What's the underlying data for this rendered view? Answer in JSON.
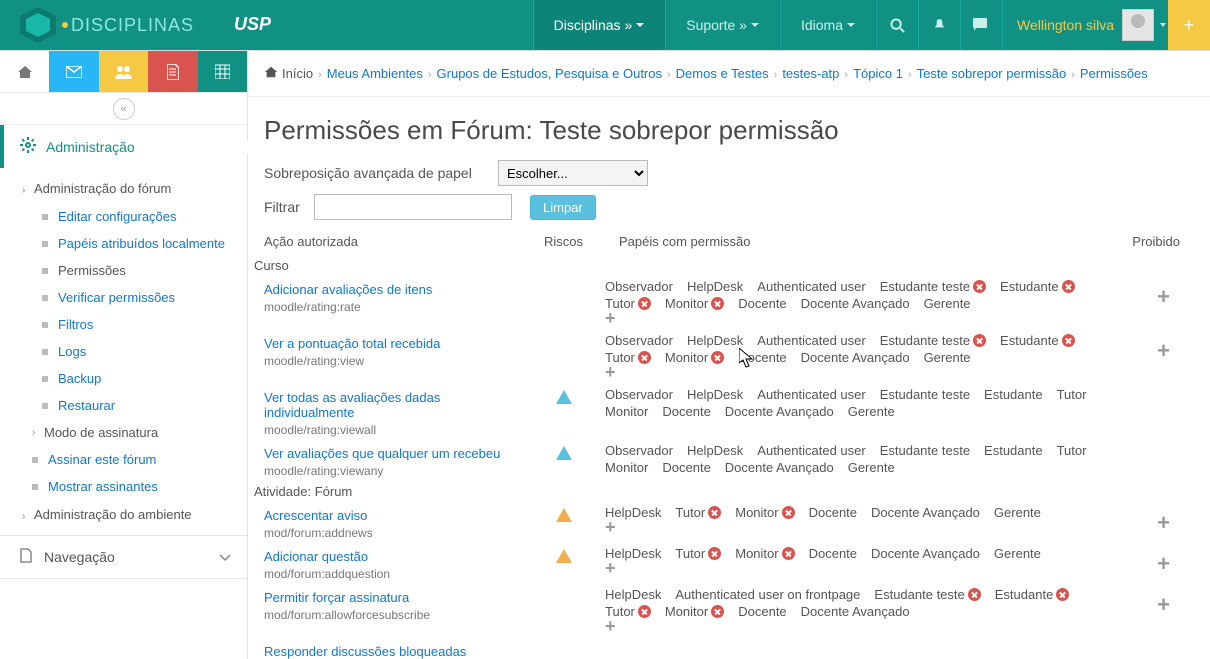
{
  "topnav": {
    "brand_text": "DISCIPLINAS",
    "menu": [
      "Disciplinas »",
      "Suporte »",
      "Idioma"
    ],
    "username": "Wellington silva"
  },
  "breadcrumb": {
    "items": [
      "Início",
      "Meus Ambientes",
      "Grupos de Estudos, Pesquisa e Outros",
      "Demos e Testes",
      "testes-atp",
      "Tópico 1",
      "Teste sobrepor permissão",
      "Permissões"
    ]
  },
  "page_title": "Permissões em Fórum: Teste sobrepor permissão",
  "form": {
    "override_label": "Sobreposição avançada de papel",
    "select_placeholder": "Escolher...",
    "filter_label": "Filtrar",
    "clear_btn": "Limpar"
  },
  "sidebar": {
    "admin_header": "Administração",
    "nav_header": "Navegação",
    "section1": "Administração do fórum",
    "section2": "Administração do ambiente",
    "items1": [
      {
        "label": "Editar configurações",
        "link": true
      },
      {
        "label": "Papéis atribuídos localmente",
        "link": true
      },
      {
        "label": "Permissões",
        "link": false,
        "current": true
      },
      {
        "label": "Verificar permissões",
        "link": true
      },
      {
        "label": "Filtros",
        "link": true
      },
      {
        "label": "Logs",
        "link": true
      },
      {
        "label": "Backup",
        "link": true
      },
      {
        "label": "Restaurar",
        "link": true
      }
    ],
    "items1b": [
      {
        "label": "Modo de assinatura",
        "link": false,
        "arrow": true
      },
      {
        "label": "Assinar este fórum",
        "link": true
      },
      {
        "label": "Mostrar assinantes",
        "link": true
      }
    ]
  },
  "table": {
    "headers": {
      "cap": "Ação autorizada",
      "risk": "Riscos",
      "roles": "Papéis com permissão",
      "proh": "Proibido"
    },
    "group1": "Curso",
    "group2": "Atividade: Fórum",
    "rows1": [
      {
        "title": "Adicionar avaliações de itens",
        "cap": "moodle/rating:rate",
        "risk": "",
        "roles": [
          {
            "n": "Observador"
          },
          {
            "n": "HelpDesk"
          },
          {
            "n": "Authenticated user"
          },
          {
            "n": "Estudante teste",
            "d": true
          },
          {
            "n": "Estudante",
            "d": true
          },
          {
            "n": "Tutor",
            "d": true
          },
          {
            "n": "Monitor",
            "d": true
          },
          {
            "n": "Docente"
          },
          {
            "n": "Docente Avançado"
          },
          {
            "n": "Gerente"
          }
        ],
        "plus": true,
        "proh": true
      },
      {
        "title": "Ver a pontuação total recebida",
        "cap": "moodle/rating:view",
        "risk": "",
        "roles": [
          {
            "n": "Observador"
          },
          {
            "n": "HelpDesk"
          },
          {
            "n": "Authenticated user"
          },
          {
            "n": "Estudante teste",
            "d": true
          },
          {
            "n": "Estudante",
            "d": true
          },
          {
            "n": "Tutor",
            "d": true
          },
          {
            "n": "Monitor",
            "d": true
          },
          {
            "n": "Docente"
          },
          {
            "n": "Docente Avançado"
          },
          {
            "n": "Gerente"
          }
        ],
        "plus": true,
        "proh": true
      },
      {
        "title": "Ver todas as avaliações dadas individualmente",
        "cap": "moodle/rating:viewall",
        "risk": "priv",
        "roles": [
          {
            "n": "Observador"
          },
          {
            "n": "HelpDesk"
          },
          {
            "n": "Authenticated user"
          },
          {
            "n": "Estudante teste"
          },
          {
            "n": "Estudante"
          },
          {
            "n": "Tutor"
          },
          {
            "n": "Monitor"
          },
          {
            "n": "Docente"
          },
          {
            "n": "Docente Avançado"
          },
          {
            "n": "Gerente"
          }
        ],
        "plus": false,
        "proh": false
      },
      {
        "title": "Ver avaliações que qualquer um recebeu",
        "cap": "moodle/rating:viewany",
        "risk": "priv",
        "roles": [
          {
            "n": "Observador"
          },
          {
            "n": "HelpDesk"
          },
          {
            "n": "Authenticated user"
          },
          {
            "n": "Estudante teste"
          },
          {
            "n": "Estudante"
          },
          {
            "n": "Tutor"
          },
          {
            "n": "Monitor"
          },
          {
            "n": "Docente"
          },
          {
            "n": "Docente Avançado"
          },
          {
            "n": "Gerente"
          }
        ],
        "plus": false,
        "proh": false
      }
    ],
    "rows2": [
      {
        "title": "Acrescentar aviso",
        "cap": "mod/forum:addnews",
        "risk": "spam",
        "roles": [
          {
            "n": "HelpDesk"
          },
          {
            "n": "Tutor",
            "d": true
          },
          {
            "n": "Monitor",
            "d": true
          },
          {
            "n": "Docente"
          },
          {
            "n": "Docente Avançado"
          },
          {
            "n": "Gerente"
          }
        ],
        "plus": true,
        "proh": true
      },
      {
        "title": "Adicionar questão",
        "cap": "mod/forum:addquestion",
        "risk": "spam",
        "roles": [
          {
            "n": "HelpDesk"
          },
          {
            "n": "Tutor",
            "d": true
          },
          {
            "n": "Monitor",
            "d": true
          },
          {
            "n": "Docente"
          },
          {
            "n": "Docente Avançado"
          },
          {
            "n": "Gerente"
          }
        ],
        "plus": true,
        "proh": true
      },
      {
        "title": "Permitir forçar assinatura",
        "cap": "mod/forum:allowforcesubscribe",
        "risk": "",
        "roles": [
          {
            "n": "HelpDesk"
          },
          {
            "n": "Authenticated user on frontpage"
          },
          {
            "n": "Estudante teste",
            "d": true
          },
          {
            "n": "Estudante",
            "d": true
          },
          {
            "n": "Tutor",
            "d": true
          },
          {
            "n": "Monitor",
            "d": true
          },
          {
            "n": "Docente"
          },
          {
            "n": "Docente Avançado"
          }
        ],
        "plus": true,
        "proh": true
      },
      {
        "title": "Responder discussões bloqueadas",
        "cap": "",
        "risk": "",
        "roles": [],
        "plus": false,
        "proh": false
      }
    ]
  }
}
